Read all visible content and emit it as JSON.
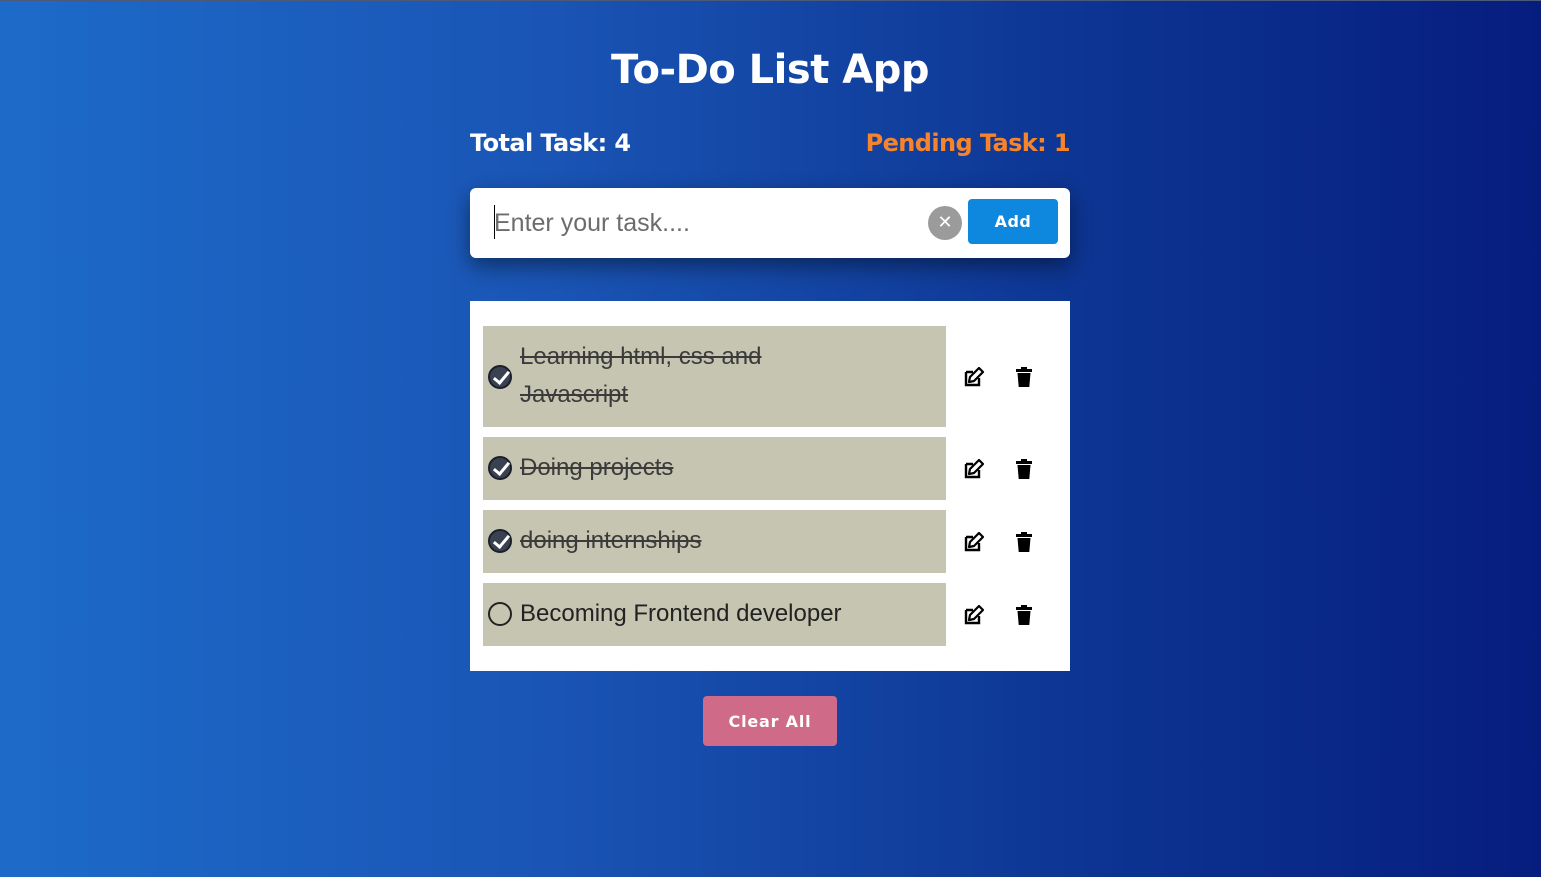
{
  "app": {
    "title": "To-Do List App"
  },
  "stats": {
    "total_label": "Total Task: 4",
    "pending_label": "Pending Task: 1",
    "pending_color": "#f7842a"
  },
  "input": {
    "placeholder": "Enter your task....",
    "value": "",
    "clear_icon": "close-icon",
    "add_label": "Add",
    "add_color": "#0e87de"
  },
  "tasks": [
    {
      "text": "Learning html, css and Javascript",
      "completed": true,
      "edit_icon": "edit-icon",
      "delete_icon": "trash-icon"
    },
    {
      "text": "Doing projects",
      "completed": true,
      "edit_icon": "edit-icon",
      "delete_icon": "trash-icon"
    },
    {
      "text": "doing internships",
      "completed": true,
      "edit_icon": "edit-icon",
      "delete_icon": "trash-icon"
    },
    {
      "text": "Becoming Frontend developer",
      "completed": false,
      "edit_icon": "edit-icon",
      "delete_icon": "trash-icon"
    }
  ],
  "footer": {
    "clear_all_label": "Clear All",
    "clear_all_color": "#cf6b88"
  },
  "colors": {
    "task_background": "#c6c5b1",
    "gradient_start": "#1d6bc9",
    "gradient_end": "#061d7e"
  }
}
